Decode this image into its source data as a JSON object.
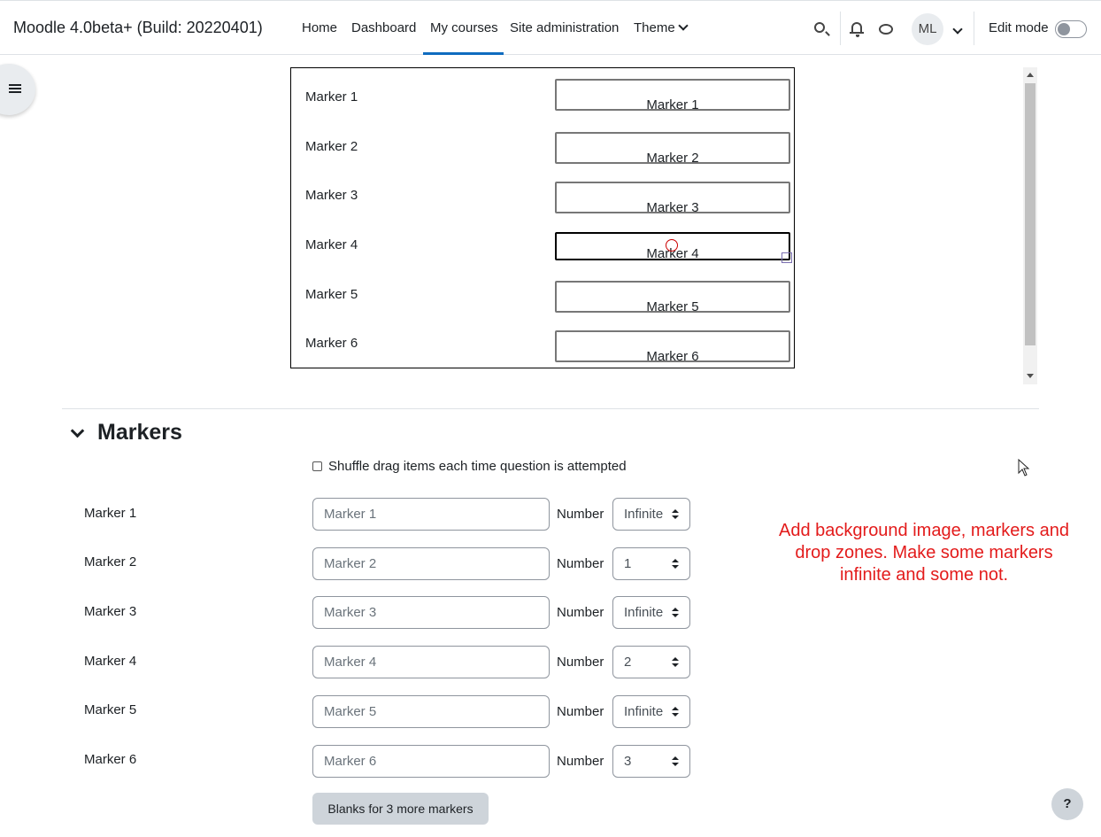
{
  "header": {
    "site_name": "Moodle 4.0beta+ (Build: 20220401)",
    "nav": [
      "Home",
      "Dashboard",
      "My courses",
      "Site administration",
      "Theme"
    ],
    "active_nav": "My courses",
    "avatar_initials": "ML",
    "edit_mode_label": "Edit mode",
    "edit_mode_on": false
  },
  "preview": {
    "labels": [
      "Marker 1",
      "Marker 2",
      "Marker 3",
      "Marker 4",
      "Marker 5",
      "Marker 6"
    ],
    "dropzones": [
      "Marker 1",
      "Marker 2",
      "Marker 3",
      "Marker 4",
      "Marker 5",
      "Marker 6"
    ]
  },
  "markers_section": {
    "title": "Markers",
    "shuffle_label": "Shuffle drag items each time question is attempted",
    "shuffle_checked": false,
    "number_label": "Number",
    "rows": [
      {
        "label": "Marker 1",
        "value": "Marker 1",
        "number": "Infinite"
      },
      {
        "label": "Marker 2",
        "value": "Marker 2",
        "number": "1"
      },
      {
        "label": "Marker 3",
        "value": "Marker 3",
        "number": "Infinite"
      },
      {
        "label": "Marker 4",
        "value": "Marker 4",
        "number": "2"
      },
      {
        "label": "Marker 5",
        "value": "Marker 5",
        "number": "Infinite"
      },
      {
        "label": "Marker 6",
        "value": "Marker 6",
        "number": "3"
      }
    ],
    "blanks_button": "Blanks for 3 more markers"
  },
  "annotation": "Add background image, markers and drop zones. Make some markers infinite and some not.",
  "help_button": "?",
  "colors": {
    "accent": "#0f6cbf",
    "annotation": "#e31b1b"
  }
}
